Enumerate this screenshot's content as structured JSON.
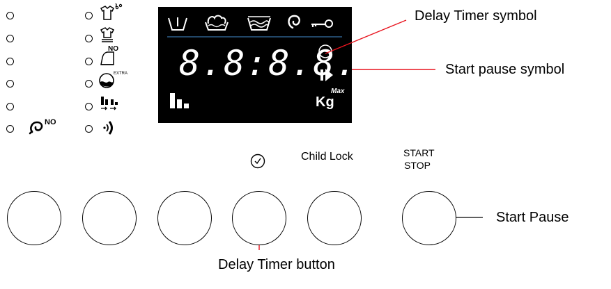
{
  "display": {
    "digits": "8.8:8.8.",
    "weight_unit": "Kg",
    "weight_sup": "Max",
    "colors": {
      "background": "#000000",
      "segments": "#ffffff",
      "divider": "#2e5f8a"
    },
    "icons": [
      "prewash-icon",
      "wash-icon",
      "rinse-icon",
      "spin-icon",
      "child-lock-key-icon",
      "delay-timer-clock-icon",
      "start-pause-play-icon",
      "load-level-bars-icon"
    ]
  },
  "buttons": {
    "child_lock_label": "Child Lock",
    "start_stop_line1": "START",
    "start_stop_line2": "STOP"
  },
  "left_option_icons": [
    "no-spin-icon",
    "steam-icon",
    "easy-iron-icon",
    "no-iron-icon",
    "extra-rinse-icon",
    "load-transfer-icon",
    "signal-sound-icon"
  ],
  "annotations": {
    "delay_timer_symbol": "Delay Timer symbol",
    "start_pause_symbol": "Start pause symbol",
    "start_pause": "Start Pause",
    "delay_timer_button": "Delay Timer button",
    "line_color": "#e8141e"
  },
  "no_spin_badge": "NO",
  "no_iron_badge": "NO",
  "extra_badge": "EXTRA"
}
